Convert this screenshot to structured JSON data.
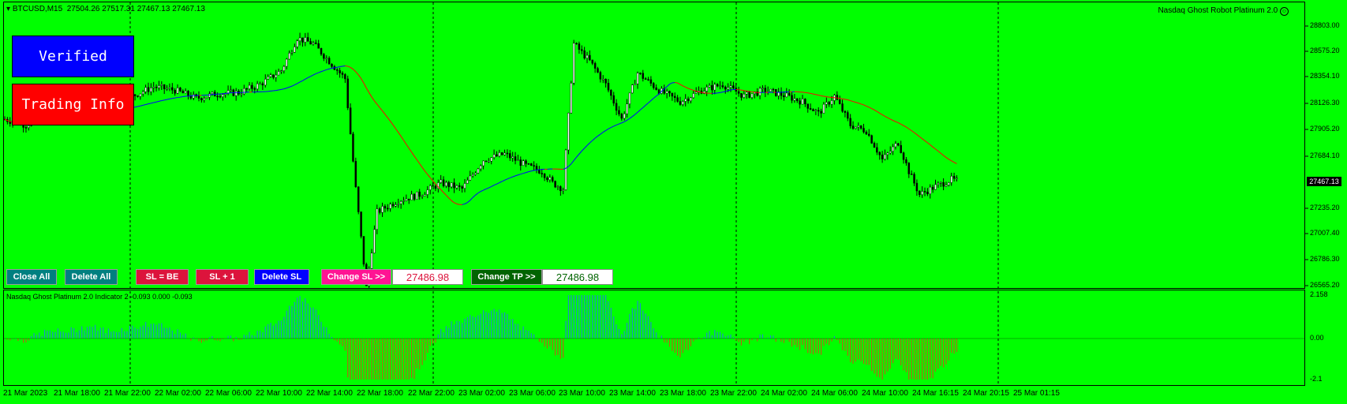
{
  "chart_header": {
    "symbol": "BTCUSD,M15",
    "ohlc": "27504.26 27517.31 27467.13 27467.13",
    "ea_name": "Nasdaq Ghost Robot Platinum 2.0"
  },
  "buttons": {
    "verified": "Verified",
    "trading_info": "Trading Info",
    "close_all": "Close All",
    "delete_all": "Delete All",
    "sl_be": "SL = BE",
    "sl_plus1": "SL + 1",
    "delete_sl": "Delete SL",
    "change_sl": "Change SL >>",
    "change_sl_value": "27486.98",
    "change_tp": "Change TP >>",
    "change_tp_value": "27486.98"
  },
  "price_axis": [
    "28803.00",
    "28575.20",
    "28354.10",
    "28126.30",
    "27905.20",
    "27684.10",
    "27235.20",
    "27007.40",
    "26786.30",
    "26565.20"
  ],
  "current_price": "27467.13",
  "indicator": {
    "label": "Nasdaq Ghost Platinum 2.0 Indicator 2 -0.093 0.000 -0.093",
    "axis": [
      "2.158",
      "0.00",
      "-2.1"
    ]
  },
  "time_axis": [
    "21 Mar 2023",
    "21 Mar 18:00",
    "21 Mar 22:00",
    "22 Mar 02:00",
    "22 Mar 06:00",
    "22 Mar 10:00",
    "22 Mar 14:00",
    "22 Mar 18:00",
    "22 Mar 22:00",
    "23 Mar 02:00",
    "23 Mar 06:00",
    "23 Mar 10:00",
    "23 Mar 14:00",
    "23 Mar 18:00",
    "23 Mar 22:00",
    "24 Mar 02:00",
    "24 Mar 06:00",
    "24 Mar 10:00",
    "24 Mar 16:15",
    "24 Mar 20:15",
    "25 Mar 01:15"
  ],
  "colors": {
    "background": "#00ff00",
    "candles": "#000000",
    "ma_fast": "#0000ff",
    "ma_slow": "#ff0000",
    "hist_positive": "#1e8cc8",
    "hist_negative": "#b46414",
    "verified_bg": "#0000ff",
    "trading_info_bg": "#ff0000",
    "close_all_bg": "#008080",
    "sl_bg": "#dc143c",
    "delete_sl_bg": "#0000ff",
    "change_sl_bg": "#ff1493",
    "change_tp_bg": "#006400"
  },
  "chart_data": {
    "type": "candlestick",
    "symbol": "BTCUSD",
    "timeframe": "M15",
    "close_path": [
      [
        0,
        28000
      ],
      [
        8,
        27950
      ],
      [
        16,
        28050
      ],
      [
        24,
        28080
      ],
      [
        32,
        28150
      ],
      [
        40,
        28120
      ],
      [
        48,
        28200
      ],
      [
        56,
        28280
      ],
      [
        64,
        28250
      ],
      [
        72,
        28180
      ],
      [
        80,
        28220
      ],
      [
        88,
        28230
      ],
      [
        96,
        28300
      ],
      [
        104,
        28420
      ],
      [
        110,
        28700
      ],
      [
        116,
        28650
      ],
      [
        122,
        28500
      ],
      [
        128,
        28350
      ],
      [
        132,
        27400
      ],
      [
        136,
        26550
      ],
      [
        140,
        27200
      ],
      [
        148,
        27300
      ],
      [
        156,
        27350
      ],
      [
        164,
        27450
      ],
      [
        172,
        27400
      ],
      [
        180,
        27650
      ],
      [
        188,
        27700
      ],
      [
        196,
        27600
      ],
      [
        202,
        27550
      ],
      [
        206,
        27450
      ],
      [
        210,
        27400
      ],
      [
        214,
        28650
      ],
      [
        220,
        28500
      ],
      [
        226,
        28300
      ],
      [
        232,
        28000
      ],
      [
        238,
        28400
      ],
      [
        246,
        28250
      ],
      [
        254,
        28150
      ],
      [
        262,
        28250
      ],
      [
        270,
        28300
      ],
      [
        278,
        28200
      ],
      [
        286,
        28250
      ],
      [
        294,
        28200
      ],
      [
        300,
        28150
      ],
      [
        306,
        28050
      ],
      [
        312,
        28200
      ],
      [
        318,
        27950
      ],
      [
        324,
        27900
      ],
      [
        330,
        27650
      ],
      [
        336,
        27800
      ],
      [
        340,
        27550
      ],
      [
        344,
        27350
      ],
      [
        350,
        27420
      ],
      [
        356,
        27480
      ],
      [
        358,
        27467
      ]
    ],
    "ma_fast": "blue moving average",
    "ma_slow": "red moving average",
    "indicator_range": [
      -2.1,
      2.158
    ]
  }
}
